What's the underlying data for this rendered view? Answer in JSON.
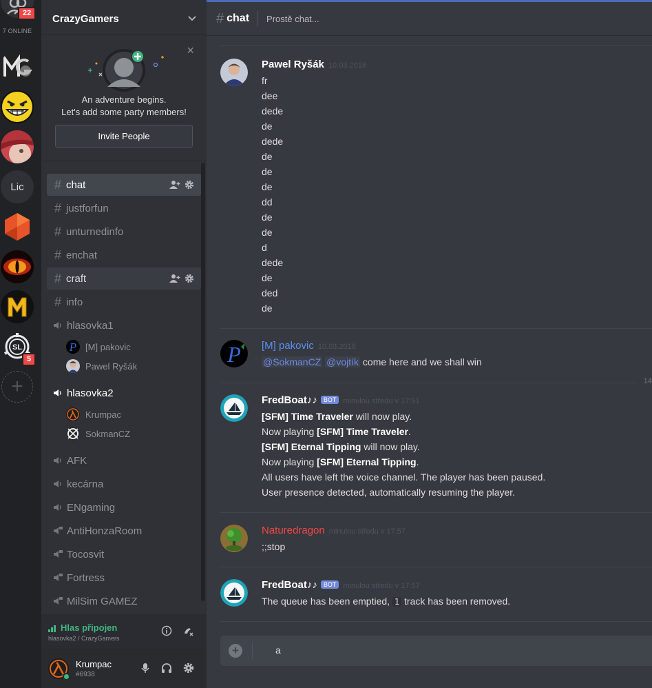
{
  "rail": {
    "friends_badge": "22",
    "online_label": "7 ONLINE",
    "servers": [
      {
        "name": "MG"
      },
      {
        "name": "grin"
      },
      {
        "name": "profile"
      },
      {
        "text": "Lic"
      },
      {
        "name": "hexagon"
      },
      {
        "name": "eye"
      },
      {
        "name": "M"
      },
      {
        "name": "SL",
        "badge": "5"
      }
    ],
    "add_server_glyph": "+"
  },
  "sidebar": {
    "guild_name": "CrazyGamers",
    "invite": {
      "close_glyph": "×",
      "line1": "An adventure begins.",
      "line2": "Let's add some party members!",
      "button": "Invite People"
    },
    "channels": [
      {
        "type": "text",
        "name": "chat"
      },
      {
        "type": "text",
        "name": "justforfun"
      },
      {
        "type": "text",
        "name": "unturnedinfo"
      },
      {
        "type": "text",
        "name": "enchat"
      },
      {
        "type": "text",
        "name": "craft"
      },
      {
        "type": "text",
        "name": "info"
      },
      {
        "type": "voice",
        "name": "hlasovka1"
      },
      {
        "type": "voice",
        "name": "hlasovka2"
      },
      {
        "type": "voice",
        "name": "AFK"
      },
      {
        "type": "voice",
        "name": "kecárna"
      },
      {
        "type": "voice",
        "name": "ENgaming"
      },
      {
        "type": "voice-locked",
        "name": "AntiHonzaRoom"
      },
      {
        "type": "voice-locked",
        "name": "Tocosvit"
      },
      {
        "type": "voice-locked",
        "name": "Fortress"
      },
      {
        "type": "voice-locked",
        "name": "MilSim GAMEZ"
      }
    ],
    "voice_users": {
      "hlasovka1": [
        "[M] pakovic",
        "Pawel Ryšák"
      ],
      "hlasovka2": [
        "Krumpac",
        "SokmanCZ"
      ]
    },
    "voice_panel": {
      "status": "Hlas připojen",
      "sub": "hlasovka2 / CrazyGamers"
    },
    "user": {
      "name": "Krumpac",
      "tag": "#6938"
    }
  },
  "chat": {
    "channel_name": "chat",
    "topic": "Prostě chat...",
    "messages": [
      {
        "author": "Pawel Ryšák",
        "time": "10.03.2018",
        "lines": [
          "fr",
          "dee",
          "dede",
          "de",
          "dede",
          "de",
          "de",
          "de",
          "dd",
          "de",
          "de",
          "d",
          "dede",
          "de",
          "ded",
          "de"
        ]
      },
      {
        "author": "[M] pakovic",
        "time": "10.03.2018",
        "mention1": "@SokmanCZ",
        "mention2": "@vojtík",
        "text": "come here and we shall win"
      },
      {
        "author": "FredBoat♪♪",
        "bot_tag": "BOT",
        "time": "minulou středu v 17:51",
        "t1": "Time Traveler",
        "t2": "Eternal Tipping",
        "sfm": "[SFM]",
        "will_play": "will now play.",
        "now_playing": "Now playing",
        "line5": "All users have left the voice channel. The player has been paused.",
        "line6": "User presence detected, automatically resuming the player."
      },
      {
        "author": "Naturedragon",
        "time": "minulou středu v 17:57",
        "text": ";;stop",
        "color": "#f04747"
      },
      {
        "author": "FredBoat♪♪",
        "bot_tag": "BOT",
        "time": "minulou středu v 17:57",
        "pre": "The queue has been emptied,",
        "code": "1",
        "post": "track has been removed."
      }
    ],
    "date_divider_label": "14",
    "composer_value": "a",
    "composer_plus": "+"
  },
  "colors": {
    "online": "#43b581",
    "mention": "#7289da",
    "danger": "#f04747",
    "accent_top": "#4a6cb3"
  }
}
